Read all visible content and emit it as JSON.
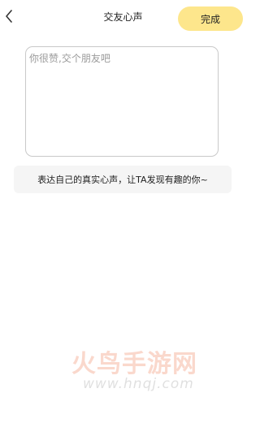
{
  "header": {
    "title": "交友心声",
    "done_label": "完成"
  },
  "editor": {
    "value": "",
    "placeholder": "你很赞,交个朋友吧"
  },
  "hint": {
    "text": "表达自己的真实心声，让TA发现有趣的你~"
  },
  "watermark": {
    "main": "火鸟手游网",
    "sub": "www.hnqj.com"
  },
  "colors": {
    "accent": "#fde68c",
    "hint_bg": "#f5f5f5"
  }
}
